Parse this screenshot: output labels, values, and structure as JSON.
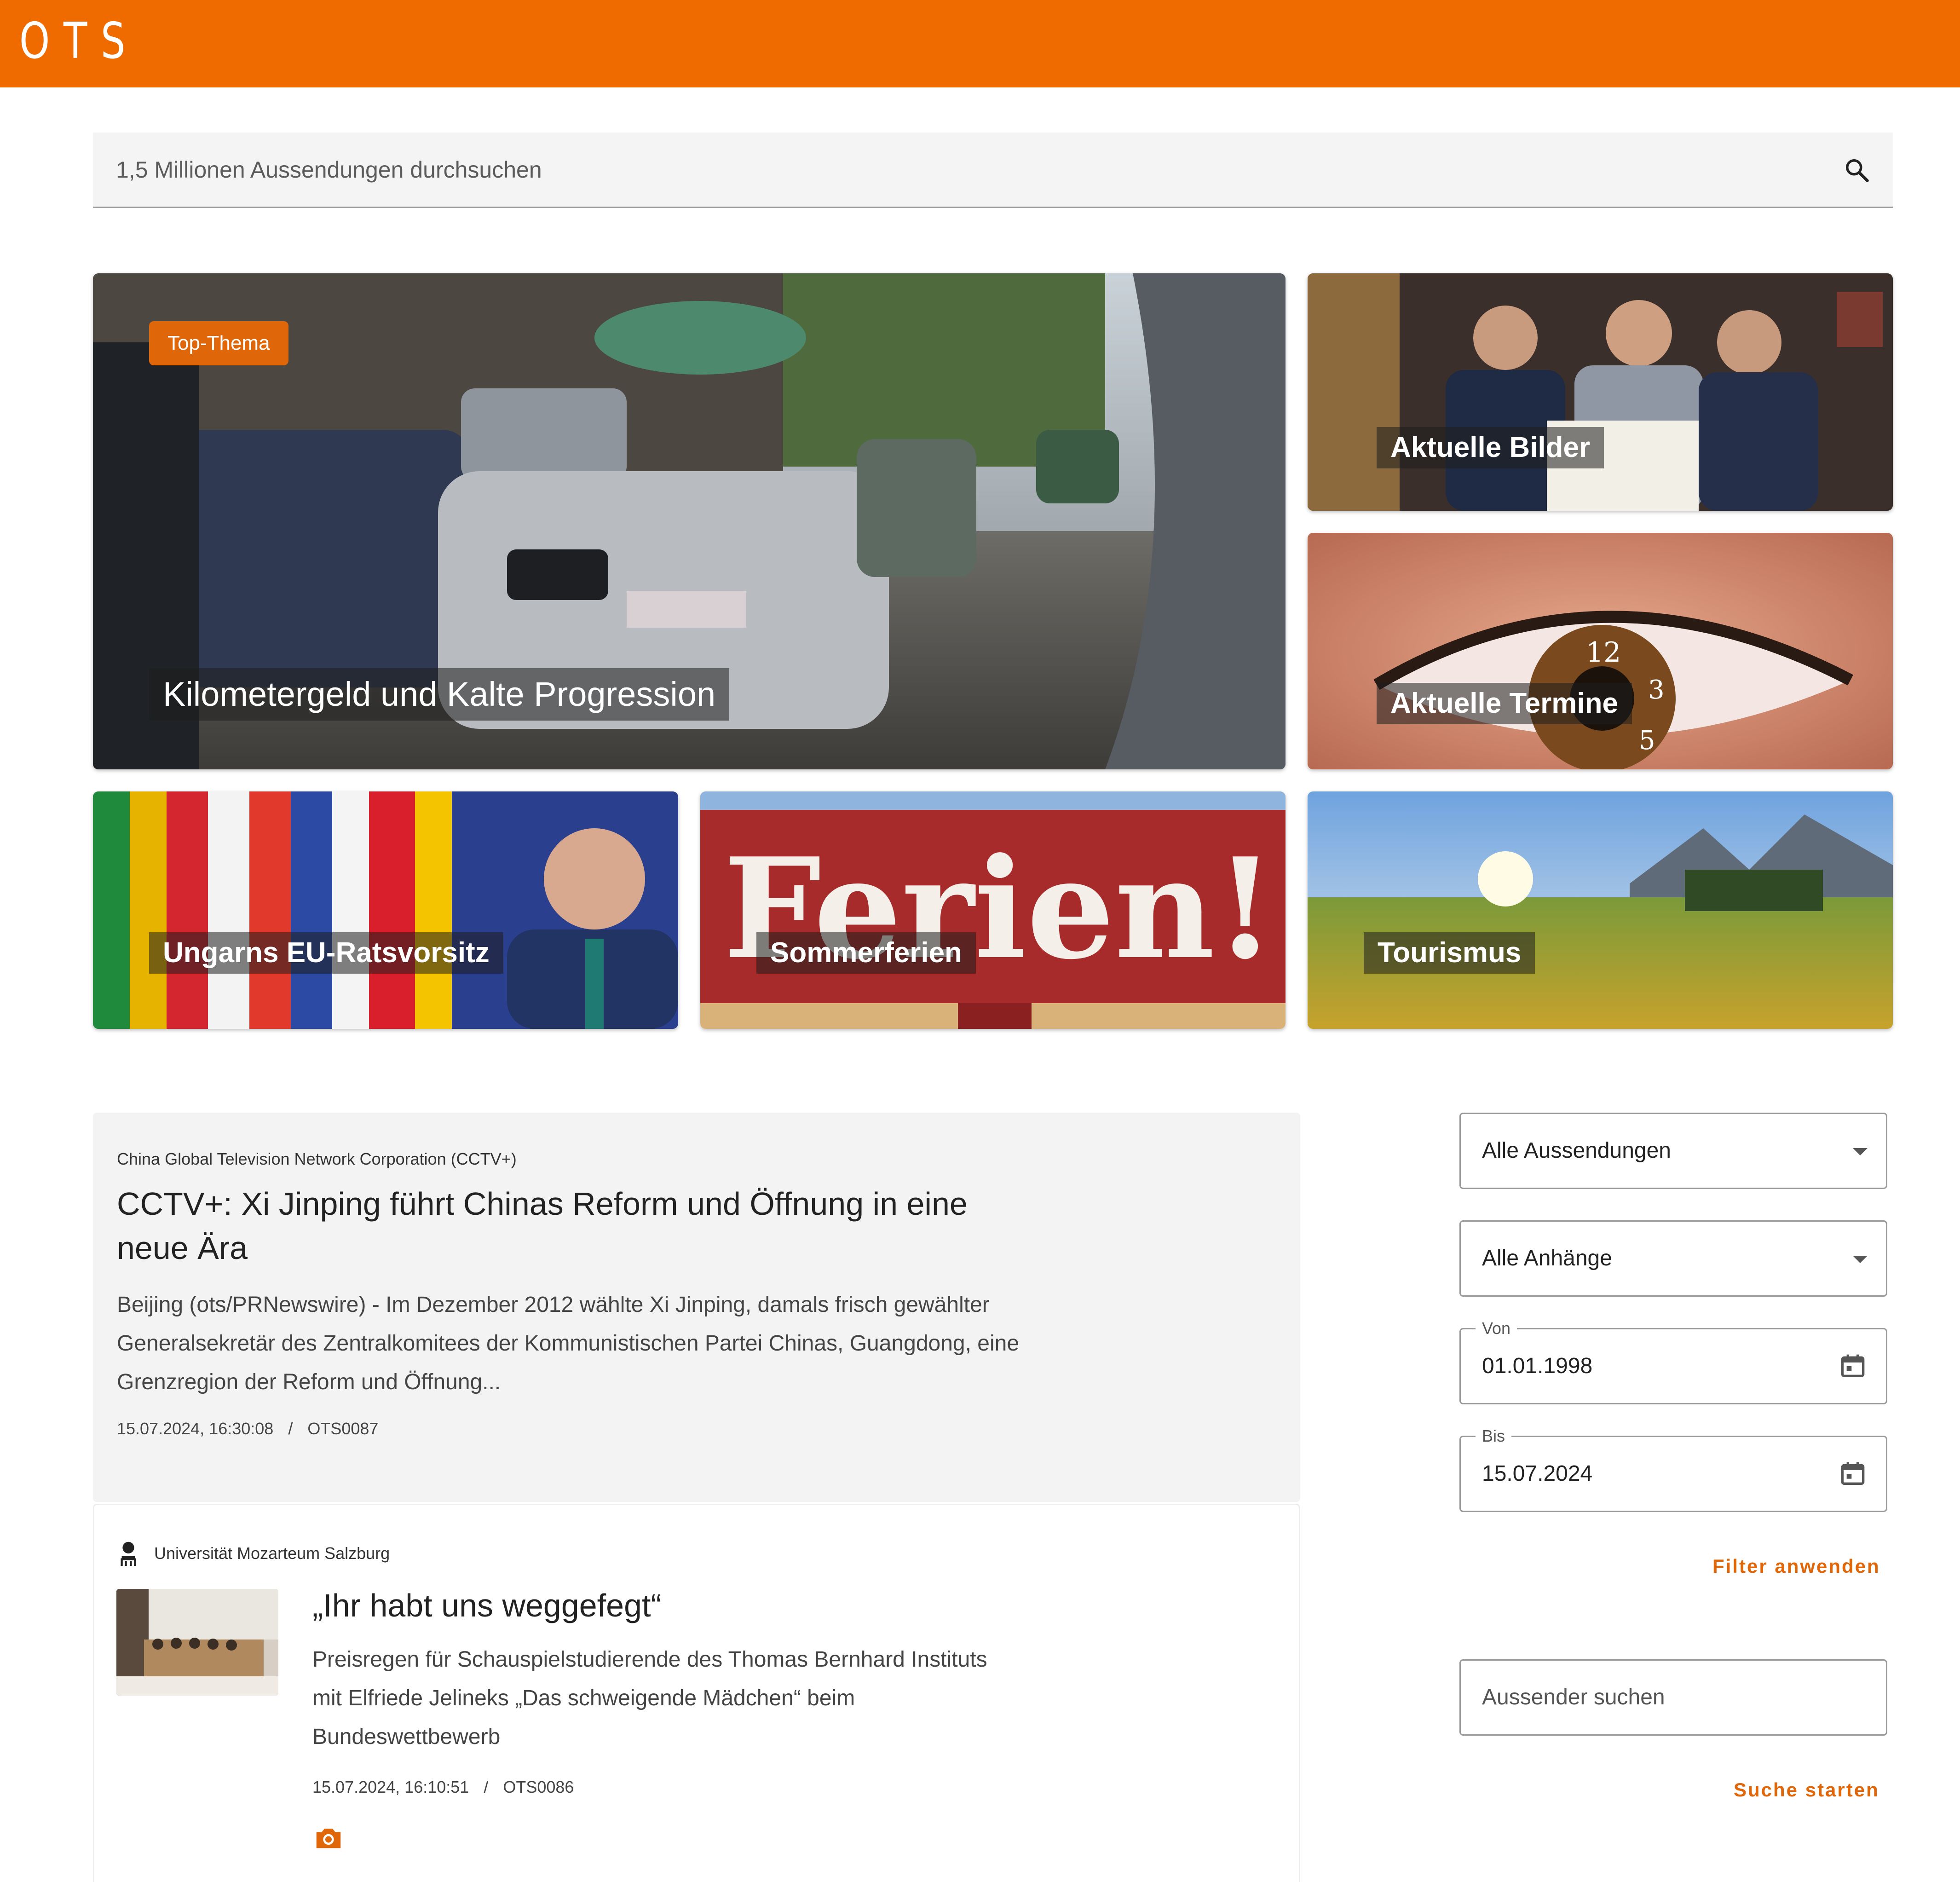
{
  "header": {
    "logo": "OTS",
    "brand_color": "#ef6b00"
  },
  "search": {
    "placeholder": "1,5 Millionen Aussendungen durchsuchen",
    "icon": "search-icon"
  },
  "tiles": {
    "top": {
      "badge": "Top-Thema",
      "title": "Kilometergeld und Kalte Progression"
    },
    "bilder": {
      "title": "Aktuelle Bilder"
    },
    "termine": {
      "title": "Aktuelle Termine"
    },
    "ungarn": {
      "title": "Ungarns EU-Ratsvorsitz"
    },
    "sommer": {
      "title": "Sommerferien",
      "sign_text": "Ferien!"
    },
    "tourismus": {
      "title": "Tourismus"
    }
  },
  "news": [
    {
      "sender": "China Global Television Network Corporation (CCTV+)",
      "title_line1": "CCTV+: Xi Jinping führt Chinas Reform und Öffnung in eine",
      "title_line2": "neue Ära",
      "teaser_line1": "Beijing (ots/PRNewswire) - Im Dezember 2012 wählte Xi Jinping, damals frisch gewählter",
      "teaser_line2": "Generalsekretär des Zentralkomitees der Kommunistischen Partei Chinas, Guangdong, eine",
      "teaser_line3": "Grenzregion der Reform und Öffnung...",
      "datetime": "15.07.2024, 16:30:08",
      "separator": "/",
      "code": "OTS0087"
    },
    {
      "sender": "Universität Mozarteum Salzburg",
      "title": "„Ihr habt uns weggefegt“",
      "teaser_line1": "Preisregen für Schauspielstudierende des Thomas Bernhard Instituts",
      "teaser_line2": "mit Elfriede Jelineks „Das schweigende Mädchen“ beim",
      "teaser_line3": "Bundeswettbewerb",
      "datetime": "15.07.2024, 16:10:51",
      "separator": "/",
      "code": "OTS0086",
      "attachment_icon": "camera-icon"
    }
  ],
  "filters": {
    "type_select": "Alle Aussendungen",
    "attachment_select": "Alle Anhänge",
    "from_label": "Von",
    "from_value": "01.01.1998",
    "to_label": "Bis",
    "to_value": "15.07.2024",
    "apply_button": "Filter anwenden",
    "sender_placeholder": "Aussender suchen",
    "search_button": "Suche starten",
    "accent_color": "#e0660a"
  }
}
